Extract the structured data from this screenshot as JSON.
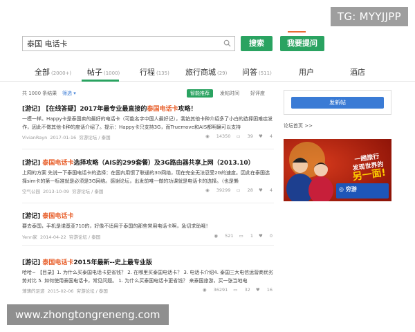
{
  "watermarks": {
    "top": "TG: MYYJJPP",
    "bottom": "www.zhongtongreneng.com"
  },
  "search": {
    "value": "泰国 电话卡",
    "search_button": "搜索",
    "ask_button": "我要提问"
  },
  "tabs": [
    {
      "label": "全部",
      "count": "(2000+)"
    },
    {
      "label": "帖子",
      "count": "(1000)"
    },
    {
      "label": "行程",
      "count": "(135)"
    },
    {
      "label": "旅行商城",
      "count": "(29)"
    },
    {
      "label": "问答",
      "count": "(511)"
    },
    {
      "label": "用户",
      "count": ""
    },
    {
      "label": "酒店",
      "count": ""
    }
  ],
  "filters": {
    "count": "共 1000 条结果",
    "select": "筛选 ▾",
    "smart": "智能推荐",
    "time": "发帖时间",
    "reply": "好评度"
  },
  "posts": [
    {
      "tag": "[游记]",
      "title_a": "【在线答疑】2017年最专业最直接的",
      "title_hl": "泰国电话卡",
      "title_b": "攻略！",
      "body": "一模一样。Happy卡是泰国卖的最好的电话卡（可能名字中国人最好记），我铂其他卡种介绍多了小白的选择困难症发作，因此不做其他卡种的度话介绍了。提示：Happy卡只支持3G，而Truemove和AIS都明确可以支持",
      "author": "VivianRayn",
      "date": "2017-01-16",
      "forum": "穷游论坛 / 泰国",
      "views": "14350",
      "replies": "39",
      "likes": "4"
    },
    {
      "tag": "[游记]",
      "title_a": "",
      "title_hl": "泰国电话卡",
      "title_b": "选择攻略（AIS的299套餐）及3G路由器共享上网（2013.10）",
      "body": "上网的方案 先说一下泰国电话卡的选择：在国内用惯了联通的3G网络，现在完全无法忍受2G的速度。因此在泰国选择sim卡的第一标准就是必须是3G网络。感谢论坛，出发前唯一做的功课就是电话卡的选择。（也是懒",
      "author": "空气公园",
      "date": "2013-10-09",
      "forum": "穷游论坛 / 泰国",
      "views": "39299",
      "replies": "28",
      "likes": "4"
    },
    {
      "tag": "[游记]",
      "title_a": "",
      "title_hl": "泰国电话卡",
      "title_b": "",
      "body": "要去泰国，手机是诺基亚710的，好像不适用于泰国的那些常用电话卡啊，急切求助哦！",
      "author": "Yenn家",
      "date": "2014-04-22",
      "forum": "穷游论坛 / 泰国",
      "views": "521",
      "replies": "1",
      "likes": "0"
    },
    {
      "tag": "[游记]",
      "title_a": "",
      "title_hl": "泰国电话卡",
      "title_b": "2015年最新--史上最专业版",
      "body": "哈哈~ 【目录】1. 为什么买泰国电话卡更省钱？ 2. 在哪里买泰国电话卡？ 3. 电话卡介绍4. 泰国三大电信运营商优劣势对比 5. 如何使用泰国电话卡，常见问题。 1. 为什么买泰国电话卡更省钱？ 来泰国旅游，买一张当地电",
      "author": "薄薄的足迹",
      "date": "2015-02-06",
      "forum": "穷游论坛 / 泰国",
      "views": "36291",
      "replies": "32",
      "likes": "16"
    }
  ],
  "sidebar": {
    "post_button": "发新帖",
    "forum_link": "论坛首页 >>",
    "ad": {
      "line1": "一趟旅行",
      "line2": "发现世界的",
      "line3": "另一面!",
      "brand": "穷游"
    }
  },
  "colors": {
    "green": "#2aa361",
    "highlight": "#e8602c",
    "blue": "#3a7bd5"
  }
}
